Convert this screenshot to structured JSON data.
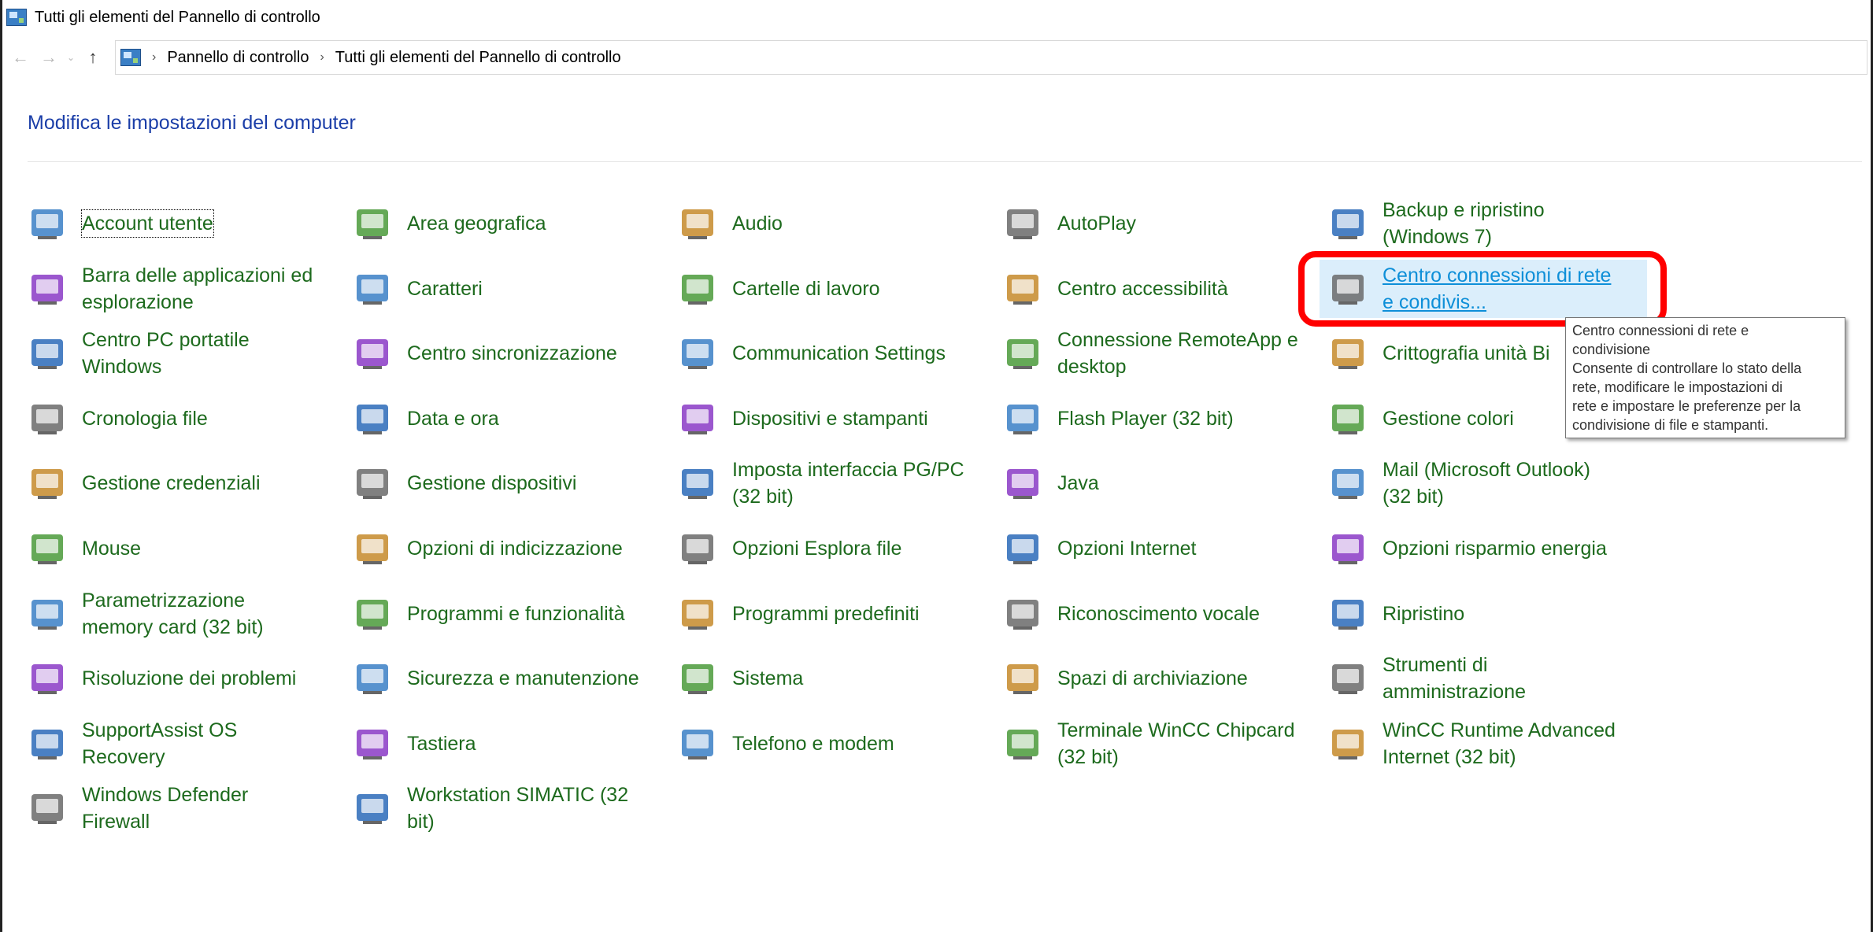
{
  "window": {
    "title": "Tutti gli elementi del Pannello di controllo"
  },
  "address": {
    "back": "←",
    "forward": "→",
    "recent": "⌄",
    "up": "↑",
    "crumbs": [
      "Pannello di controllo",
      "Tutti gli elementi del Pannello di controllo"
    ]
  },
  "page": {
    "title": "Modifica le impostazioni del computer"
  },
  "items": [
    {
      "line1": "Account utente",
      "line2": "",
      "icon": "users-icon"
    },
    {
      "line1": "Area geografica",
      "line2": "",
      "icon": "globe-clock-icon"
    },
    {
      "line1": "Audio",
      "line2": "",
      "icon": "speaker-icon"
    },
    {
      "line1": "AutoPlay",
      "line2": "",
      "icon": "autoplay-icon"
    },
    {
      "line1": "Backup e ripristino",
      "line2": "(Windows 7)",
      "icon": "backup-icon"
    },
    {
      "line1": "Barra delle applicazioni ed",
      "line2": "esplorazione",
      "icon": "taskbar-icon"
    },
    {
      "line1": "Caratteri",
      "line2": "",
      "icon": "fonts-icon"
    },
    {
      "line1": "Cartelle di lavoro",
      "line2": "",
      "icon": "work-folders-icon"
    },
    {
      "line1": "Centro accessibilità",
      "line2": "",
      "icon": "accessibility-icon"
    },
    {
      "line1": "Centro connessioni di rete",
      "line2": "e condivis...",
      "icon": "network-icon"
    },
    {
      "line1": "Centro PC portatile",
      "line2": "Windows",
      "icon": "mobility-icon"
    },
    {
      "line1": "Centro sincronizzazione",
      "line2": "",
      "icon": "sync-icon"
    },
    {
      "line1": "Communication Settings",
      "line2": "",
      "icon": "comset-icon"
    },
    {
      "line1": "Connessione RemoteApp e",
      "line2": "desktop",
      "icon": "remoteapp-icon"
    },
    {
      "line1": "Crittografia unità Bi",
      "line2": "",
      "icon": "bitlocker-icon"
    },
    {
      "line1": "Cronologia file",
      "line2": "",
      "icon": "file-history-icon"
    },
    {
      "line1": "Data e ora",
      "line2": "",
      "icon": "calendar-clock-icon"
    },
    {
      "line1": "Dispositivi e stampanti",
      "line2": "",
      "icon": "printer-icon"
    },
    {
      "line1": "Flash Player (32 bit)",
      "line2": "",
      "icon": "flash-icon"
    },
    {
      "line1": "Gestione colori",
      "line2": "",
      "icon": "color-icon"
    },
    {
      "line1": "Gestione credenziali",
      "line2": "",
      "icon": "safe-icon"
    },
    {
      "line1": "Gestione dispositivi",
      "line2": "",
      "icon": "device-manager-icon"
    },
    {
      "line1": "Imposta interfaccia PG/PC",
      "line2": "(32 bit)",
      "icon": "pgpc-icon"
    },
    {
      "line1": "Java",
      "line2": "",
      "icon": "java-icon"
    },
    {
      "line1": "Mail (Microsoft Outlook)",
      "line2": "(32 bit)",
      "icon": "mail-icon"
    },
    {
      "line1": "Mouse",
      "line2": "",
      "icon": "mouse-icon"
    },
    {
      "line1": "Opzioni di indicizzazione",
      "line2": "",
      "icon": "indexing-icon"
    },
    {
      "line1": "Opzioni Esplora file",
      "line2": "",
      "icon": "folder-options-icon"
    },
    {
      "line1": "Opzioni Internet",
      "line2": "",
      "icon": "internet-icon"
    },
    {
      "line1": "Opzioni risparmio energia",
      "line2": "",
      "icon": "power-icon"
    },
    {
      "line1": "Parametrizzazione",
      "line2": "memory card (32 bit)",
      "icon": "memory-card-icon"
    },
    {
      "line1": "Programmi e funzionalità",
      "line2": "",
      "icon": "programs-icon"
    },
    {
      "line1": "Programmi predefiniti",
      "line2": "",
      "icon": "default-programs-icon"
    },
    {
      "line1": "Riconoscimento vocale",
      "line2": "",
      "icon": "microphone-icon"
    },
    {
      "line1": "Ripristino",
      "line2": "",
      "icon": "recovery-icon"
    },
    {
      "line1": "Risoluzione dei problemi",
      "line2": "",
      "icon": "troubleshoot-icon"
    },
    {
      "line1": "Sicurezza e manutenzione",
      "line2": "",
      "icon": "flag-icon"
    },
    {
      "line1": "Sistema",
      "line2": "",
      "icon": "system-icon"
    },
    {
      "line1": "Spazi di archiviazione",
      "line2": "",
      "icon": "storage-icon"
    },
    {
      "line1": "Strumenti di",
      "line2": "amministrazione",
      "icon": "admin-tools-icon"
    },
    {
      "line1": "SupportAssist OS",
      "line2": "Recovery",
      "icon": "supportassist-icon"
    },
    {
      "line1": "Tastiera",
      "line2": "",
      "icon": "keyboard-icon"
    },
    {
      "line1": "Telefono e modem",
      "line2": "",
      "icon": "phone-icon"
    },
    {
      "line1": "Terminale WinCC Chipcard",
      "line2": "(32 bit)",
      "icon": "chipcard-icon"
    },
    {
      "line1": "WinCC Runtime Advanced",
      "line2": "Internet (32 bit)",
      "icon": "wincc-icon"
    },
    {
      "line1": "Windows Defender",
      "line2": "Firewall",
      "icon": "firewall-icon"
    },
    {
      "line1": "Workstation SIMATIC (32",
      "line2": "bit)",
      "icon": "document-icon"
    }
  ],
  "tooltip": {
    "title1": "Centro connessioni di rete e",
    "title2": "condivisione",
    "body1": "Consente di controllare lo stato della",
    "body2": "rete, modificare le impostazioni di",
    "body3": "rete e impostare le preferenze per la",
    "body4": "condivisione di file e stampanti."
  }
}
